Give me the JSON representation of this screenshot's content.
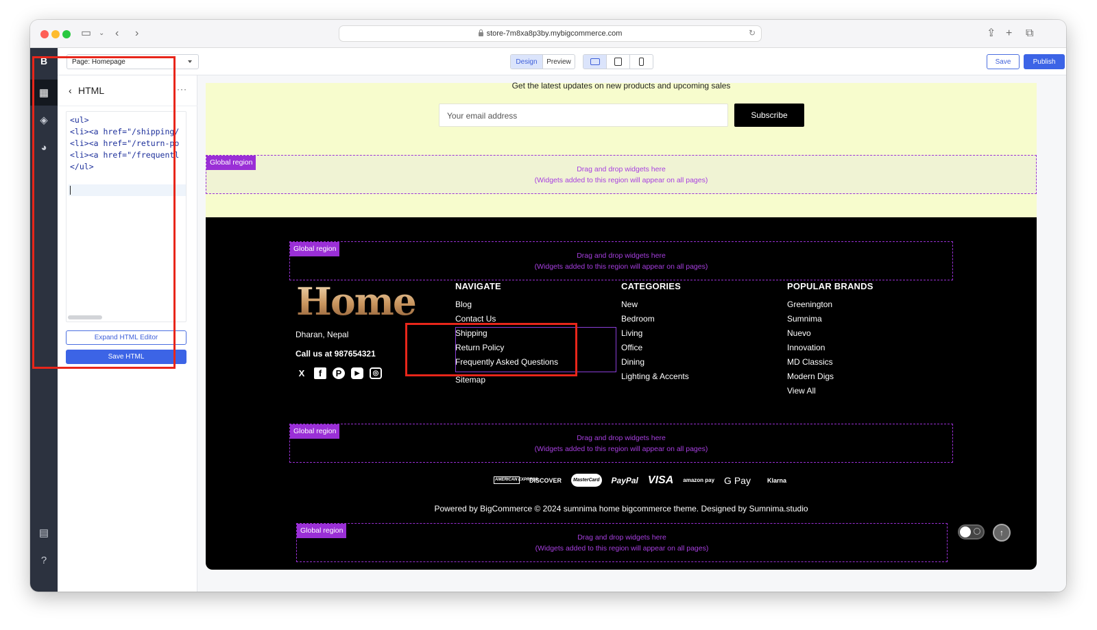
{
  "browser": {
    "url": "store-7m8xa8p3by.mybigcommerce.com"
  },
  "toolbar": {
    "page_select": "Page: Homepage",
    "design_label": "Design",
    "preview_label": "Preview",
    "save_label": "Save",
    "publish_label": "Publish"
  },
  "panel": {
    "title": "HTML",
    "code_lines": [
      {
        "tag": "<ul>",
        "rest": ""
      },
      {
        "tag": "<li><a",
        "rest": " href=\"/shipping/"
      },
      {
        "tag": "<li><a",
        "rest": " href=\"/return-po"
      },
      {
        "tag": "<li><a",
        "rest": " href=\"/frequentl"
      },
      {
        "tag": "</ul>",
        "rest": ""
      }
    ],
    "expand_label": "Expand HTML Editor",
    "save_html_label": "Save HTML"
  },
  "newsletter": {
    "text": "Get the latest updates on new products and upcoming sales",
    "email_placeholder": "Your email address",
    "subscribe_label": "Subscribe"
  },
  "region": {
    "tag": "Global region",
    "line1": "Drag and drop widgets here",
    "line2": "(Widgets added to this region will appear on all pages)"
  },
  "footer": {
    "logo": "Home",
    "address": "Dharan, Nepal",
    "call": "Call us at 987654321",
    "social": [
      "X",
      "f",
      "P",
      "▶",
      "◎"
    ],
    "navigate": {
      "heading": "NAVIGATE",
      "links": [
        "Blog",
        "Contact Us",
        "Shipping",
        "Return Policy",
        "Frequently Asked Questions",
        "Sitemap"
      ]
    },
    "categories": {
      "heading": "CATEGORIES",
      "links": [
        "New",
        "Bedroom",
        "Living",
        "Office",
        "Dining",
        "Lighting & Accents"
      ]
    },
    "brands": {
      "heading": "POPULAR BRANDS",
      "links": [
        "Greenington",
        "Sumnima",
        "Nuevo",
        "Innovation",
        "MD Classics",
        "Modern Digs",
        "View All"
      ]
    },
    "payments": [
      "AMERICAN EXPRESS",
      "DISCOVER",
      "MasterCard",
      "PayPal",
      "VISA",
      "amazon pay",
      "G Pay",
      "Klarna"
    ],
    "powered": "Powered by BigCommerce © 2024 sumnima home bigcommerce theme. Designed by Sumnima.studio"
  },
  "colors": {
    "accent": "#3c64e6",
    "region": "#9a2fd6",
    "highlight": "#e8261a",
    "newsletter_bg": "#f7fccd"
  }
}
